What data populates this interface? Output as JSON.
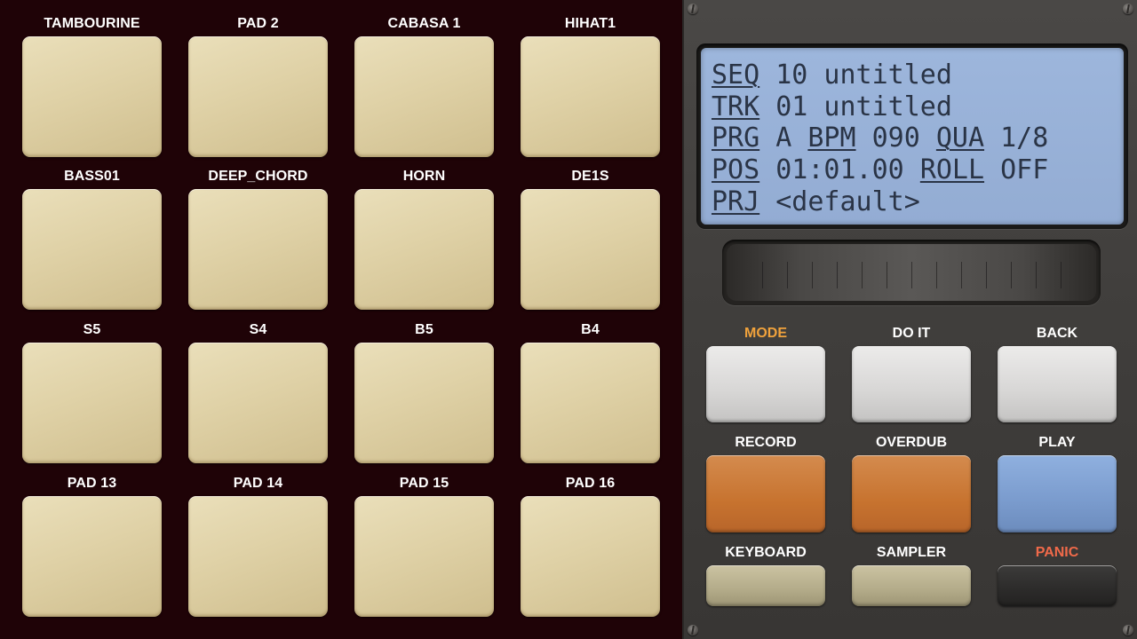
{
  "pads": [
    {
      "label": "TAMBOURINE"
    },
    {
      "label": "PAD 2"
    },
    {
      "label": "CABASA 1"
    },
    {
      "label": "HIHAT1"
    },
    {
      "label": "BASS01"
    },
    {
      "label": "DEEP_CHORD"
    },
    {
      "label": "HORN"
    },
    {
      "label": "DE1S"
    },
    {
      "label": "S5"
    },
    {
      "label": "S4"
    },
    {
      "label": "B5"
    },
    {
      "label": "B4"
    },
    {
      "label": "PAD 13"
    },
    {
      "label": "PAD 14"
    },
    {
      "label": "PAD 15"
    },
    {
      "label": "PAD 16"
    }
  ],
  "lcd": {
    "seq_key": "SEQ",
    "seq_value": " 10 untitled",
    "trk_key": "TRK",
    "trk_value": " 01 untitled",
    "prg_key": "PRG",
    "prg_value": " A ",
    "bpm_key": "BPM",
    "bpm_value": " 090 ",
    "qua_key": "QUA",
    "qua_value": " 1/8",
    "pos_key": "POS",
    "pos_value": " 01:01.00 ",
    "roll_key": "ROLL",
    "roll_value": " OFF",
    "prj_key": "PRJ",
    "prj_value": " <default>"
  },
  "controls": {
    "mode_label": "MODE",
    "doit_label": "DO IT",
    "back_label": "BACK",
    "record_label": "RECORD",
    "overdub_label": "OVERDUB",
    "play_label": "PLAY",
    "keyboard_label": "KEYBOARD",
    "sampler_label": "SAMPLER",
    "panic_label": "PANIC"
  },
  "colors": {
    "pad_area_bg": "#1f0307",
    "panel_bg": "#403e3c",
    "lcd_bg": "#9db6dc",
    "lcd_text": "#2a3446",
    "pad": "#dfd1a6",
    "mode_label": "#f0a23c",
    "panic_label": "#f06a4a",
    "record_btn": "#c7732f",
    "overdub_btn": "#c7732f",
    "play_btn": "#7a9bcd",
    "keyboard_btn": "#b3ab89",
    "sampler_btn": "#b3ab89",
    "panic_btn": "#2c2b2a"
  }
}
